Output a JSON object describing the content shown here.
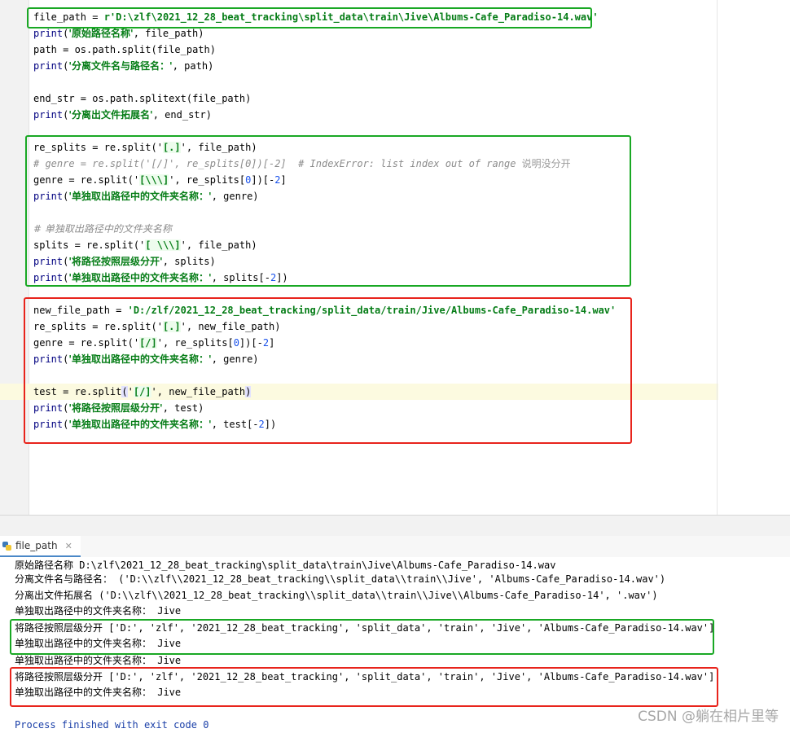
{
  "editor": {
    "lines": [
      [
        {
          "t": "file_path = "
        },
        {
          "t": "r'D:\\zlf\\2021_12_28_beat_tracking\\split_data\\train\\Jive\\Albums-Cafe_Paradiso-14.wav'",
          "k": "s"
        }
      ],
      [
        {
          "t": "print",
          "k": "bi"
        },
        {
          "t": "("
        },
        {
          "t": "'原始路径名称'",
          "k": "s cn"
        },
        {
          "t": ", file_path)"
        }
      ],
      [
        {
          "t": "path = os.path.split(file_path)"
        }
      ],
      [
        {
          "t": "print",
          "k": "bi"
        },
        {
          "t": "("
        },
        {
          "t": "'分离文件名与路径名：'",
          "k": "s cn"
        },
        {
          "t": ", path)"
        }
      ],
      [],
      [
        {
          "t": "end_str = os.path.splitext(file_path)"
        }
      ],
      [
        {
          "t": "print",
          "k": "bi"
        },
        {
          "t": "("
        },
        {
          "t": "'分离出文件拓展名'",
          "k": "s cn"
        },
        {
          "t": ", end_str)"
        }
      ],
      [],
      [
        {
          "t": "re_splits = re.split("
        },
        {
          "t": "'"
        },
        {
          "t": "[.]",
          "k": "re"
        },
        {
          "t": "'"
        },
        {
          "t": ", file_path)"
        }
      ],
      [
        {
          "t": "# genre = re.split('[/]', re_splits[0])[-2]  # IndexError: list index out of range ",
          "k": "c"
        },
        {
          "t": "说明没分开",
          "k": "c cs cn"
        }
      ],
      [
        {
          "t": "genre = re.split("
        },
        {
          "t": "'"
        },
        {
          "t": "[\\\\\\]",
          "k": "re"
        },
        {
          "t": "'"
        },
        {
          "t": ", re_splits["
        },
        {
          "t": "0",
          "k": "n"
        },
        {
          "t": "])[-"
        },
        {
          "t": "2",
          "k": "n"
        },
        {
          "t": "]"
        }
      ],
      [
        {
          "t": "print",
          "k": "bi"
        },
        {
          "t": "("
        },
        {
          "t": "'单独取出路径中的文件夹名称：'",
          "k": "s cn"
        },
        {
          "t": ", genre)"
        }
      ],
      [],
      [
        {
          "t": "# 单独取出路径中的文件夹名称",
          "k": "c cn"
        }
      ],
      [
        {
          "t": "splits = re.split("
        },
        {
          "t": "'"
        },
        {
          "t": "[ \\\\\\]",
          "k": "re"
        },
        {
          "t": "'"
        },
        {
          "t": ", file_path)"
        }
      ],
      [
        {
          "t": "print",
          "k": "bi"
        },
        {
          "t": "("
        },
        {
          "t": "'将路径按照层级分开'",
          "k": "s cn"
        },
        {
          "t": ", splits)"
        }
      ],
      [
        {
          "t": "print",
          "k": "bi"
        },
        {
          "t": "("
        },
        {
          "t": "'单独取出路径中的文件夹名称：'",
          "k": "s cn"
        },
        {
          "t": ", splits[-"
        },
        {
          "t": "2",
          "k": "n"
        },
        {
          "t": "])"
        }
      ],
      [],
      [
        {
          "t": "new_file_path = "
        },
        {
          "t": "'D:/zlf/2021_12_28_beat_tracking/split_data/train/Jive/Albums-Cafe_Paradiso-14.wav'",
          "k": "s"
        }
      ],
      [
        {
          "t": "re_splits = re.split("
        },
        {
          "t": "'"
        },
        {
          "t": "[.]",
          "k": "re"
        },
        {
          "t": "'"
        },
        {
          "t": ", new_file_path)"
        }
      ],
      [
        {
          "t": "genre = re.split("
        },
        {
          "t": "'"
        },
        {
          "t": "[/]",
          "k": "re"
        },
        {
          "t": "'"
        },
        {
          "t": ", re_splits["
        },
        {
          "t": "0",
          "k": "n"
        },
        {
          "t": "])[-"
        },
        {
          "t": "2",
          "k": "n"
        },
        {
          "t": "]"
        }
      ],
      [
        {
          "t": "print",
          "k": "bi"
        },
        {
          "t": "("
        },
        {
          "t": "'单独取出路径中的文件夹名称：'",
          "k": "s cn"
        },
        {
          "t": ", genre)"
        }
      ],
      [],
      [
        {
          "t": "test = re.split"
        },
        {
          "t": "(",
          "k": "br"
        },
        {
          "t": "'"
        },
        {
          "t": "[/]",
          "k": "re"
        },
        {
          "t": "'"
        },
        {
          "t": ", new_file_path"
        },
        {
          "t": ")",
          "k": "br"
        }
      ],
      [
        {
          "t": "print",
          "k": "bi"
        },
        {
          "t": "("
        },
        {
          "t": "'将路径按照层级分开'",
          "k": "s cn"
        },
        {
          "t": ", test)"
        }
      ],
      [
        {
          "t": "print",
          "k": "bi"
        },
        {
          "t": "("
        },
        {
          "t": "'单独取出路径中的文件夹名称：'",
          "k": "s cn"
        },
        {
          "t": ", test[-"
        },
        {
          "t": "2",
          "k": "n"
        },
        {
          "t": "])"
        }
      ]
    ]
  },
  "run": {
    "tab_label": "file_path",
    "output": [
      "原始路径名称 D:\\zlf\\2021_12_28_beat_tracking\\split_data\\train\\Jive\\Albums-Cafe_Paradiso-14.wav",
      "分离文件名与路径名： ('D:\\\\zlf\\\\2021_12_28_beat_tracking\\\\split_data\\\\train\\\\Jive', 'Albums-Cafe_Paradiso-14.wav')",
      "分离出文件拓展名 ('D:\\\\zlf\\\\2021_12_28_beat_tracking\\\\split_data\\\\train\\\\Jive\\\\Albums-Cafe_Paradiso-14', '.wav')",
      "单独取出路径中的文件夹名称： Jive",
      "将路径按照层级分开 ['D:', 'zlf', '2021_12_28_beat_tracking', 'split_data', 'train', 'Jive', 'Albums-Cafe_Paradiso-14.wav']",
      "单独取出路径中的文件夹名称： Jive",
      "单独取出路径中的文件夹名称： Jive",
      "将路径按照层级分开 ['D:', 'zlf', '2021_12_28_beat_tracking', 'split_data', 'train', 'Jive', 'Albums-Cafe_Paradiso-14.wav']",
      "单独取出路径中的文件夹名称： Jive",
      "",
      "Process finished with exit code 0"
    ]
  },
  "watermark": "CSDN @躺在相片里等",
  "colors": {
    "annotation_green": "#19a824",
    "annotation_red": "#e8241c",
    "string": "#067d17",
    "builtin": "#000080",
    "comment": "#8c8c8c",
    "number": "#1750eb"
  }
}
